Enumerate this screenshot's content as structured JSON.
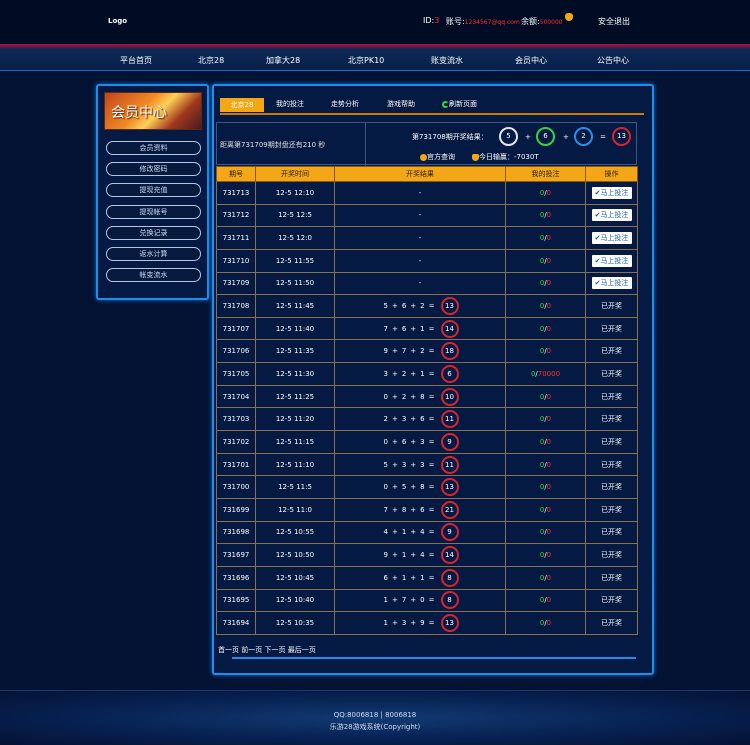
{
  "topbar": {
    "logo": "Logo",
    "id_label": "ID:",
    "id_value": "3",
    "account_label": "账号:",
    "account_value": "1234567@qq.com",
    "balance_label": "余额:",
    "balance_value": "500000",
    "logout": "安全退出"
  },
  "nav": [
    "平台首页",
    "北京28",
    "加拿大28",
    "北京PK10",
    "账变流水",
    "会员中心",
    "公告中心"
  ],
  "sidebar": {
    "banner": "会员中心",
    "items": [
      "会员资料",
      "修改密码",
      "提现充值",
      "提现帐号",
      "兑换记录",
      "返水计算",
      "帐变流水"
    ]
  },
  "tabs": {
    "active": "北京28",
    "items": [
      "我的投注",
      "走势分析",
      "游戏帮助",
      "刷新页面"
    ]
  },
  "info": {
    "countdown": "距离第731709期封盘还有210 秒",
    "result_label": "第731708期开奖结果：",
    "result": [
      "5",
      "6",
      "2",
      "13"
    ],
    "ops": [
      "+",
      "+",
      "="
    ],
    "official": "官方查询",
    "today_profit_label": "今日输赢：",
    "today_profit_value": "-7030T"
  },
  "table": {
    "headers": [
      "期号",
      "开奖时间",
      "开奖结果",
      "我的投注",
      "操作"
    ],
    "bet_button": "马上投注",
    "opened": "已开奖",
    "rows": [
      {
        "issue": "731713",
        "time": "12-5  12:10",
        "result": null,
        "bet_a": "0",
        "bet_b": "0",
        "action": "bet"
      },
      {
        "issue": "731712",
        "time": "12-5  12:5",
        "result": null,
        "bet_a": "0",
        "bet_b": "0",
        "action": "bet"
      },
      {
        "issue": "731711",
        "time": "12-5  12:0",
        "result": null,
        "bet_a": "0",
        "bet_b": "0",
        "action": "bet"
      },
      {
        "issue": "731710",
        "time": "12-5  11:55",
        "result": null,
        "bet_a": "0",
        "bet_b": "0",
        "action": "bet"
      },
      {
        "issue": "731709",
        "time": "12-5  11:50",
        "result": null,
        "bet_a": "0",
        "bet_b": "0",
        "action": "bet"
      },
      {
        "issue": "731708",
        "time": "12-5  11:45",
        "result": {
          "a": "5",
          "b": "6",
          "c": "2",
          "sum": "13"
        },
        "bet_a": "0",
        "bet_b": "0",
        "action": "opened"
      },
      {
        "issue": "731707",
        "time": "12-5  11:40",
        "result": {
          "a": "7",
          "b": "6",
          "c": "1",
          "sum": "14"
        },
        "bet_a": "0",
        "bet_b": "0",
        "action": "opened"
      },
      {
        "issue": "731706",
        "time": "12-5  11:35",
        "result": {
          "a": "9",
          "b": "7",
          "c": "2",
          "sum": "18"
        },
        "bet_a": "0",
        "bet_b": "0",
        "action": "opened"
      },
      {
        "issue": "731705",
        "time": "12-5  11:30",
        "result": {
          "a": "3",
          "b": "2",
          "c": "1",
          "sum": "6"
        },
        "bet_a": "0",
        "bet_b": "70000",
        "action": "opened"
      },
      {
        "issue": "731704",
        "time": "12-5  11:25",
        "result": {
          "a": "0",
          "b": "2",
          "c": "8",
          "sum": "10"
        },
        "bet_a": "0",
        "bet_b": "0",
        "action": "opened"
      },
      {
        "issue": "731703",
        "time": "12-5  11:20",
        "result": {
          "a": "2",
          "b": "3",
          "c": "6",
          "sum": "11"
        },
        "bet_a": "0",
        "bet_b": "0",
        "action": "opened"
      },
      {
        "issue": "731702",
        "time": "12-5  11:15",
        "result": {
          "a": "0",
          "b": "6",
          "c": "3",
          "sum": "9"
        },
        "bet_a": "0",
        "bet_b": "0",
        "action": "opened"
      },
      {
        "issue": "731701",
        "time": "12-5  11:10",
        "result": {
          "a": "5",
          "b": "3",
          "c": "3",
          "sum": "11"
        },
        "bet_a": "0",
        "bet_b": "0",
        "action": "opened"
      },
      {
        "issue": "731700",
        "time": "12-5  11:5",
        "result": {
          "a": "0",
          "b": "5",
          "c": "8",
          "sum": "13"
        },
        "bet_a": "0",
        "bet_b": "0",
        "action": "opened"
      },
      {
        "issue": "731699",
        "time": "12-5  11:0",
        "result": {
          "a": "7",
          "b": "8",
          "c": "6",
          "sum": "21"
        },
        "bet_a": "0",
        "bet_b": "0",
        "action": "opened"
      },
      {
        "issue": "731698",
        "time": "12-5  10:55",
        "result": {
          "a": "4",
          "b": "1",
          "c": "4",
          "sum": "9"
        },
        "bet_a": "0",
        "bet_b": "0",
        "action": "opened"
      },
      {
        "issue": "731697",
        "time": "12-5  10:50",
        "result": {
          "a": "9",
          "b": "1",
          "c": "4",
          "sum": "14"
        },
        "bet_a": "0",
        "bet_b": "0",
        "action": "opened"
      },
      {
        "issue": "731696",
        "time": "12-5  10:45",
        "result": {
          "a": "6",
          "b": "1",
          "c": "1",
          "sum": "8"
        },
        "bet_a": "0",
        "bet_b": "0",
        "action": "opened"
      },
      {
        "issue": "731695",
        "time": "12-5  10:40",
        "result": {
          "a": "1",
          "b": "7",
          "c": "0",
          "sum": "8"
        },
        "bet_a": "0",
        "bet_b": "0",
        "action": "opened"
      },
      {
        "issue": "731694",
        "time": "12-5  10:35",
        "result": {
          "a": "1",
          "b": "3",
          "c": "9",
          "sum": "13"
        },
        "bet_a": "0",
        "bet_b": "0",
        "action": "opened"
      }
    ]
  },
  "pager": [
    "首一页",
    "前一页",
    "下一页",
    "最后一页"
  ],
  "footer": {
    "line1": "QQ:8006818 | 8006818",
    "line2": "乐游28游戏系统(Copyright)"
  },
  "colors": {
    "accent": "#f3a716",
    "border_blue": "#1c8fe8",
    "ball_red": "#d8242c",
    "bg": "#041233"
  },
  "icons": {
    "balance": "money-bag-icon",
    "refresh": "refresh-icon",
    "bet": "checkmark-icon",
    "official": "lookup-icon",
    "profit": "money-bag-icon"
  }
}
